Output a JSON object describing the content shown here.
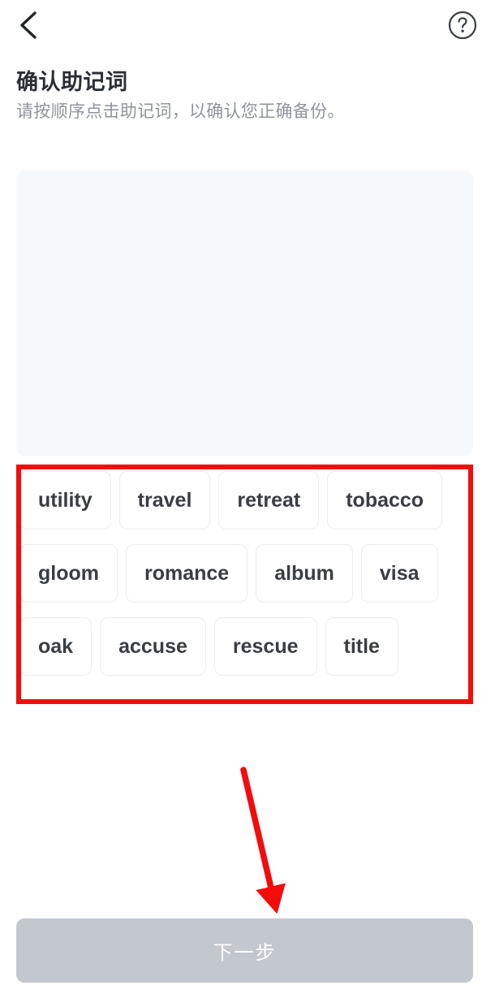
{
  "nav": {
    "back_icon": "chevron-left-icon",
    "help_icon": "question-mark-circle-icon"
  },
  "header": {
    "title": "确认助记词",
    "subtitle": "请按顺序点击助记词，以确认您正确备份。"
  },
  "answer_panel": {
    "selected_words": []
  },
  "word_bank": {
    "words": [
      "utility",
      "travel",
      "retreat",
      "tobacco",
      "gloom",
      "romance",
      "album",
      "visa",
      "oak",
      "accuse",
      "rescue",
      "title"
    ]
  },
  "footer": {
    "next_label": "下一步",
    "next_enabled": false
  },
  "annotations": {
    "rect_color": "#f40b0b",
    "arrow_color": "#f40b0b"
  },
  "colors": {
    "background": "#ffffff",
    "title_text": "#2b2f36",
    "subtitle_text": "#8f949c",
    "panel_fill": "#f6f9fc",
    "chip_fill": "#ffffff",
    "chip_border": "#ededf0",
    "chip_text": "#3a3d42",
    "button_disabled": "#c3c7ce",
    "button_text": "#ffffff",
    "annotation_red": "#f40b0b"
  }
}
